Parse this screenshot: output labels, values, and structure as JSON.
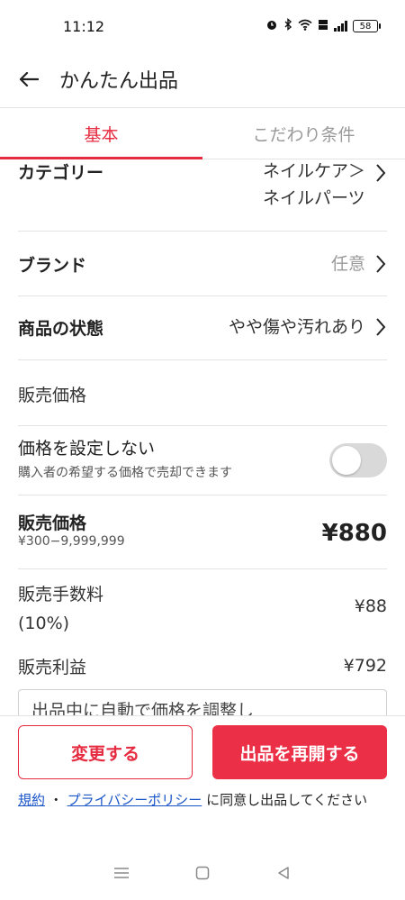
{
  "status_bar": {
    "time": "11:12",
    "battery": "58"
  },
  "app_bar": {
    "title": "かんたん出品"
  },
  "tabs": [
    {
      "label": "基本",
      "active": true
    },
    {
      "label": "こだわり条件",
      "active": false
    }
  ],
  "category": {
    "label": "カテゴリー",
    "value_line1": "ネイルケア＞",
    "value_line2": "ネイルパーツ"
  },
  "brand": {
    "label": "ブランド",
    "value": "任意"
  },
  "condition": {
    "label": "商品の状態",
    "value": "やや傷や汚れあり"
  },
  "price_section": {
    "heading": "販売価格"
  },
  "no_price": {
    "label": "価格を設定しない",
    "sub": "購入者の希望する価格で売却できます",
    "enabled": false
  },
  "price": {
    "label": "販売価格",
    "range": "¥300−9,999,999",
    "value": "¥880"
  },
  "fee": {
    "label_line1": "販売手数料",
    "label_line2": "(10%)",
    "value": "¥88"
  },
  "profit": {
    "label": "販売利益",
    "value": "¥792"
  },
  "partial_text": "出品中に自動で価格を調整し",
  "footer": {
    "change_button": "変更する",
    "relist_button": "出品を再開する",
    "terms_link": "規約",
    "terms_sep": "・",
    "privacy_link": "プライバシーポリシー",
    "terms_suffix": "に同意し出品してください"
  },
  "colors": {
    "accent": "#e62b40",
    "link": "#1a55c8",
    "divider": "#e3e3e3"
  }
}
